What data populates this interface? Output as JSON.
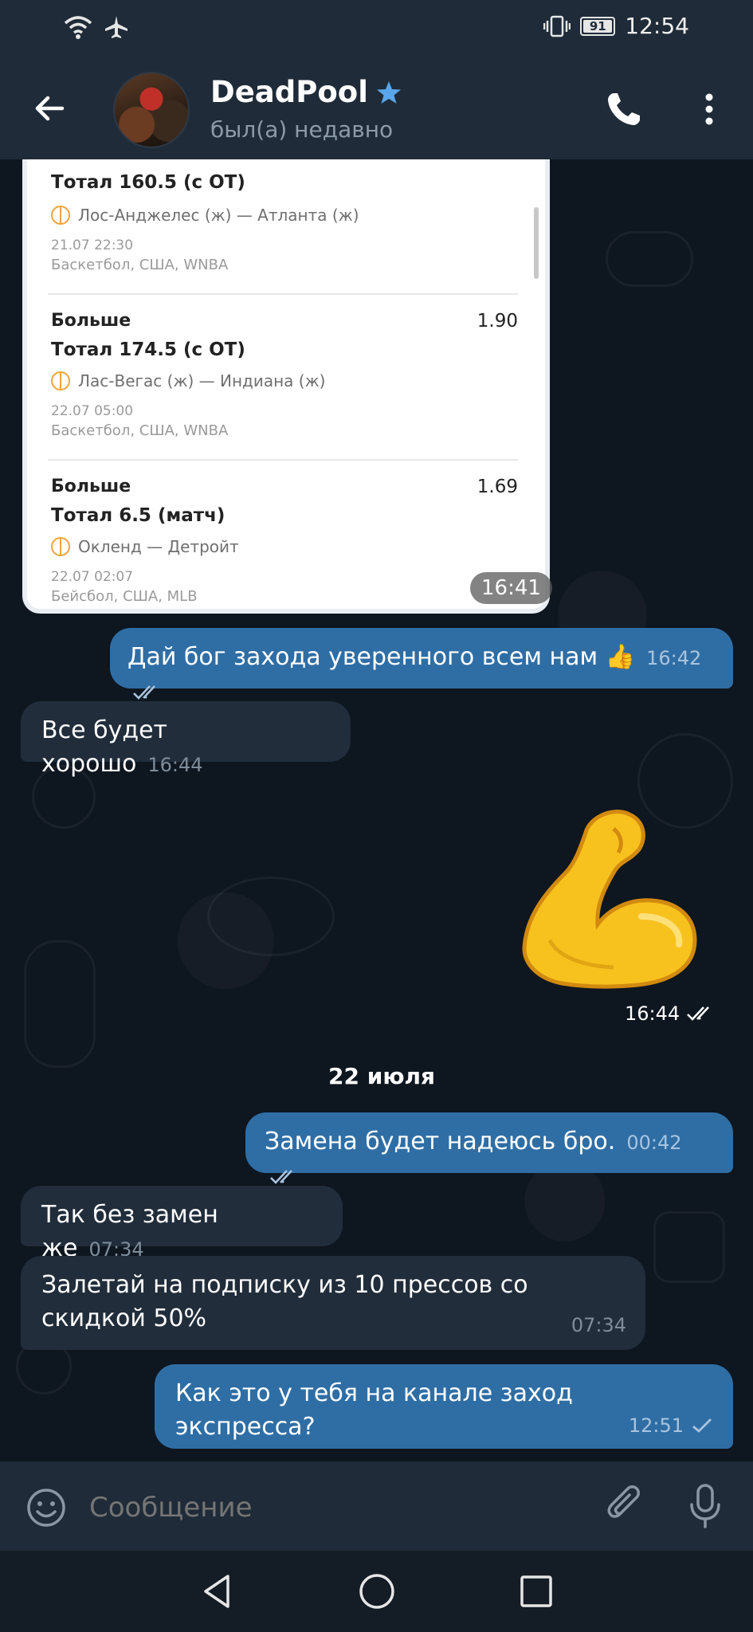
{
  "status_bar": {
    "battery": "91",
    "time": "12:54"
  },
  "header": {
    "name": "DeadPool",
    "status": "был(а) недавно"
  },
  "bets": [
    {
      "label": "",
      "odds": "",
      "total": "Тотал 160.5 (с ОТ)",
      "match": "Лос-Анджелес (ж) — Атланта (ж)",
      "date": "21.07 22:30",
      "league": "Баскетбол, США, WNBA"
    },
    {
      "label": "Больше",
      "odds": "1.90",
      "total": "Тотал 174.5 (с ОТ)",
      "match": "Лас-Вегас (ж) — Индиана (ж)",
      "date": "22.07 05:00",
      "league": "Баскетбол, США, WNBA"
    },
    {
      "label": "Больше",
      "odds": "1.69",
      "total": "Тотал 6.5 (матч)",
      "match": "Окленд — Детройт",
      "date": "22.07 02:07",
      "league": "Бейсбол, США, MLB"
    }
  ],
  "image_time": "16:41",
  "messages": [
    {
      "text": "Дай бог захода уверенного всем нам 👍",
      "time": "16:42"
    },
    {
      "text": "Все будет хорошо",
      "time": "16:44"
    },
    {
      "text": "Замена будет надеюсь бро.",
      "time": "00:42"
    },
    {
      "text": "Так без замен же",
      "time": "07:34"
    },
    {
      "text": "Залетай на подписку из 10 прессов со скидкой 50%",
      "time": "07:34"
    },
    {
      "text": "Как это  у тебя на канале заход экспресса?",
      "time": "12:51"
    }
  ],
  "sticker_time": "16:44",
  "date_separator": "22 июля",
  "input": {
    "placeholder": "Сообщение"
  }
}
